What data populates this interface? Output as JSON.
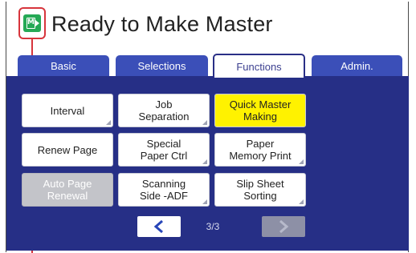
{
  "header": {
    "title": "Ready to Make Master",
    "status_icon": "master-making-icon"
  },
  "tabs": [
    {
      "label": "Basic",
      "active": false
    },
    {
      "label": "Selections",
      "active": false
    },
    {
      "label": "Functions",
      "active": true
    },
    {
      "label": "Admin.",
      "active": false
    }
  ],
  "buttons": [
    {
      "label": "Interval",
      "state": "normal"
    },
    {
      "label": "Job\nSeparation",
      "state": "normal"
    },
    {
      "label": "Quick Master\nMaking",
      "state": "highlighted"
    },
    {
      "label": "Renew Page",
      "state": "normal"
    },
    {
      "label": "Special\nPaper Ctrl",
      "state": "normal"
    },
    {
      "label": "Paper\nMemory Print",
      "state": "normal"
    },
    {
      "label": "Auto Page\nRenewal",
      "state": "disabled"
    },
    {
      "label": "Scanning\nSide -ADF",
      "state": "normal"
    },
    {
      "label": "Slip Sheet\nSorting",
      "state": "normal"
    }
  ],
  "pager": {
    "page_text": "3/3",
    "prev_icon": "chevron-left-icon",
    "next_icon": "chevron-right-icon"
  },
  "colors": {
    "panel_bg": "#262f86",
    "highlight": "#fff200",
    "callout": "#d7353c",
    "status_green": "#25a955"
  }
}
